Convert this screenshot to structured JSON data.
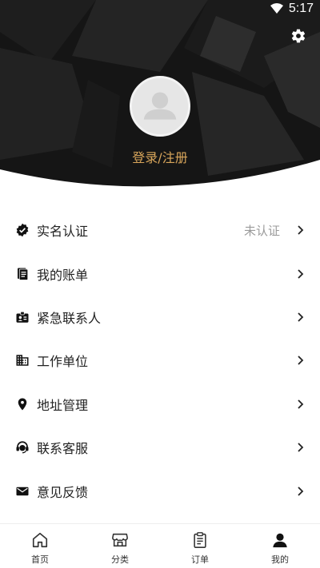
{
  "status_bar": {
    "time": "5:17",
    "wifi_icon": "wifi-icon"
  },
  "header": {
    "settings_icon": "gear-icon",
    "avatar_icon": "default-avatar-icon",
    "login_label": "登录/注册",
    "accent_color": "#d9a65b",
    "background_color": "#141414"
  },
  "menu": {
    "items": [
      {
        "label": "实名认证",
        "value": "未认证",
        "icon": "verified-badge-icon"
      },
      {
        "label": "我的账单",
        "value": "",
        "icon": "bill-icon"
      },
      {
        "label": "紧急联系人",
        "value": "",
        "icon": "contact-card-icon"
      },
      {
        "label": "工作单位",
        "value": "",
        "icon": "building-icon"
      },
      {
        "label": "地址管理",
        "value": "",
        "icon": "location-pin-icon"
      },
      {
        "label": "联系客服",
        "value": "",
        "icon": "headset-icon"
      },
      {
        "label": "意见反馈",
        "value": "",
        "icon": "mail-icon"
      }
    ]
  },
  "bottom_nav": {
    "tabs": [
      {
        "label": "首页",
        "icon": "home-icon"
      },
      {
        "label": "分类",
        "icon": "shop-icon"
      },
      {
        "label": "订单",
        "icon": "clipboard-icon"
      },
      {
        "label": "我的",
        "icon": "person-icon",
        "active": true
      }
    ]
  }
}
